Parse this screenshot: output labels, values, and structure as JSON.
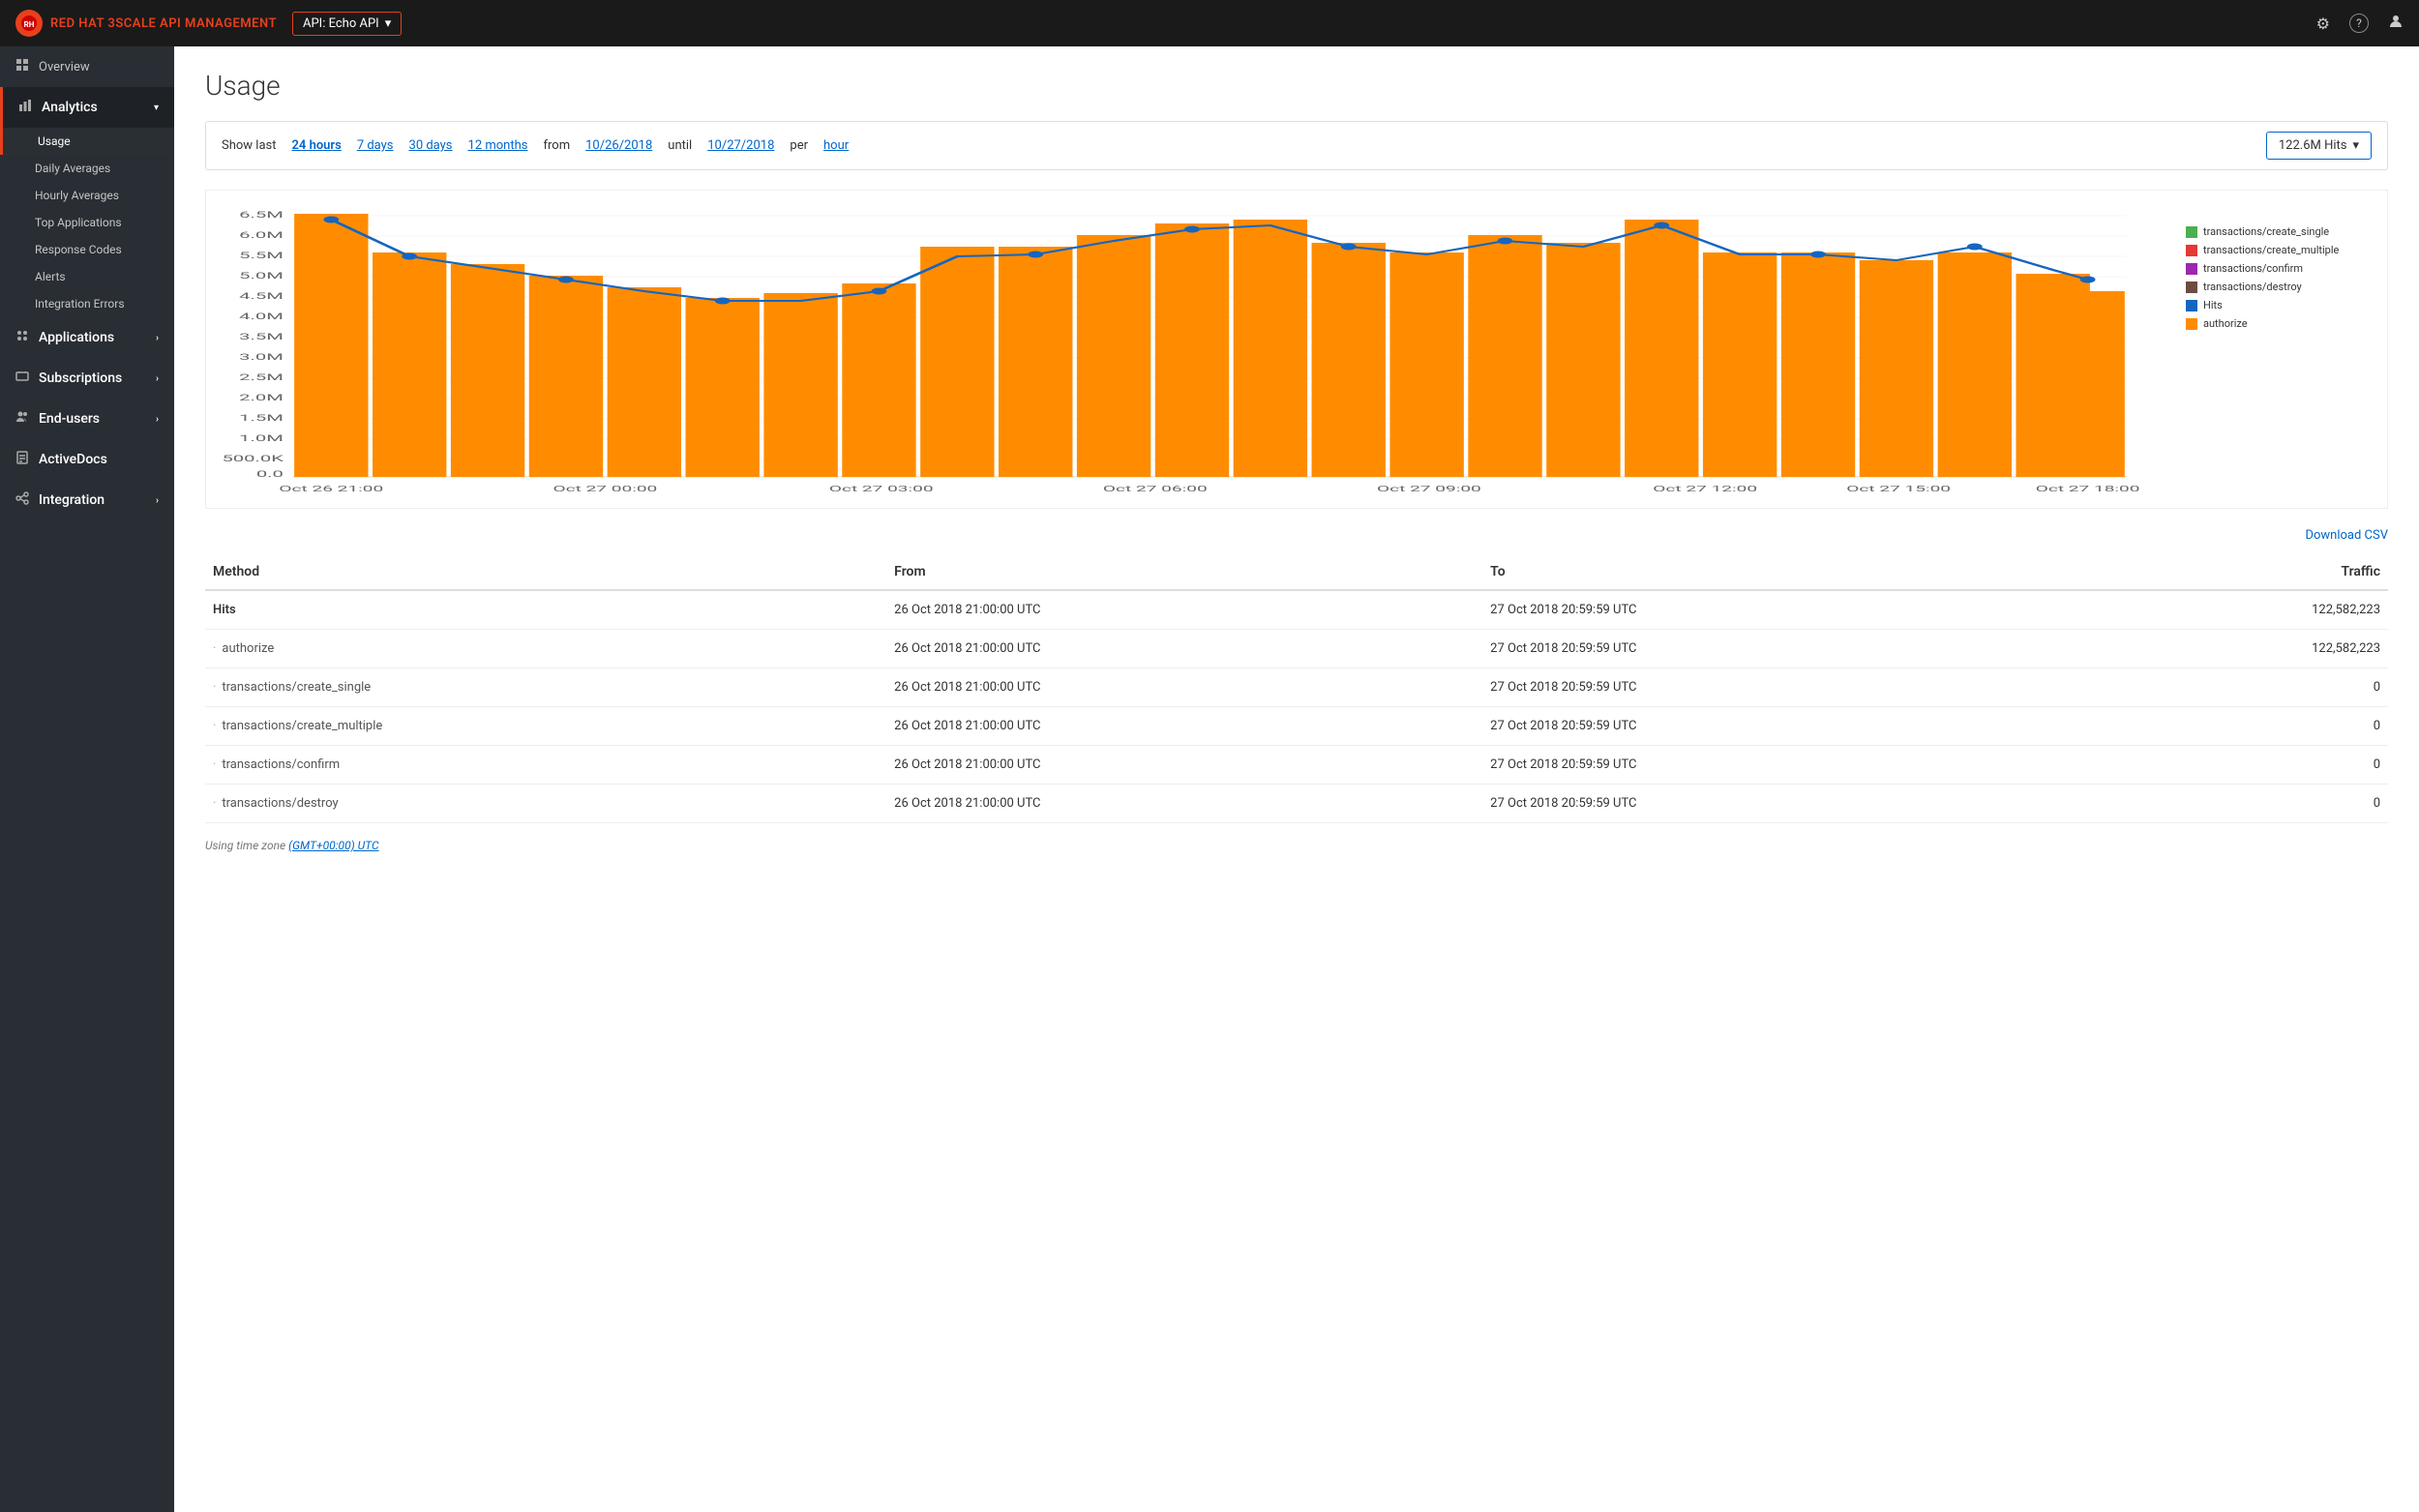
{
  "topnav": {
    "logo_icon": "3S",
    "logo_prefix": "RED HAT ",
    "logo_brand": "3SCALE",
    "logo_suffix": " API MANAGEMENT",
    "api_selector_label": "API: Echo API",
    "gear_icon": "⚙",
    "help_icon": "?",
    "user_icon": "👤"
  },
  "sidebar": {
    "overview_label": "Overview",
    "analytics_label": "Analytics",
    "usage_label": "Usage",
    "daily_averages_label": "Daily Averages",
    "hourly_averages_label": "Hourly Averages",
    "top_applications_label": "Top Applications",
    "response_codes_label": "Response Codes",
    "alerts_label": "Alerts",
    "integration_errors_label": "Integration Errors",
    "applications_label": "Applications",
    "subscriptions_label": "Subscriptions",
    "end_users_label": "End-users",
    "activedocs_label": "ActiveDocs",
    "integration_label": "Integration"
  },
  "page": {
    "title": "Usage"
  },
  "filter": {
    "show_last_label": "Show last",
    "hours_24": "24 hours",
    "days_7": "7 days",
    "days_30": "30 days",
    "months_12": "12 months",
    "from_label": "from",
    "from_date": "10/26/2018",
    "until_label": "until",
    "until_date": "10/27/2018",
    "per_label": "per",
    "period": "hour",
    "hits_label": "122.6M Hits"
  },
  "legend": {
    "items": [
      {
        "label": "transactions/create_single",
        "color": "#4caf50"
      },
      {
        "label": "transactions/create_multiple",
        "color": "#e53935"
      },
      {
        "label": "transactions/confirm",
        "color": "#9c27b0"
      },
      {
        "label": "transactions/destroy",
        "color": "#6d4c41"
      },
      {
        "label": "Hits",
        "color": "#1565c0"
      },
      {
        "label": "authorize",
        "color": "#ff8c00"
      }
    ]
  },
  "chart": {
    "y_labels": [
      "6.5M",
      "6.0M",
      "5.5M",
      "5.0M",
      "4.5M",
      "4.0M",
      "3.5M",
      "3.0M",
      "2.5M",
      "2.0M",
      "1.5M",
      "1.0M",
      "500.0K",
      "0.0"
    ],
    "x_labels": [
      "Oct 26 21:00",
      "Oct 27 00:00",
      "Oct 27 03:00",
      "Oct 27 06:00",
      "Oct 27 09:00",
      "Oct 27 12:00",
      "Oct 27 15:00",
      "Oct 27 18:00"
    ],
    "bars": [
      100,
      87,
      82,
      78,
      74,
      70,
      72,
      75,
      88,
      88,
      92,
      95,
      96,
      90,
      88,
      92,
      90,
      96,
      88,
      88,
      85,
      88,
      80,
      75
    ],
    "line": [
      96,
      87,
      82,
      76,
      72,
      68,
      68,
      72,
      80,
      82,
      86,
      90,
      93,
      88,
      86,
      89,
      87,
      93,
      85,
      85,
      82,
      86,
      78,
      73
    ]
  },
  "download_csv_label": "Download CSV",
  "table": {
    "headers": [
      "Method",
      "From",
      "To",
      "Traffic"
    ],
    "rows": [
      {
        "method": "Hits",
        "from": "26 Oct 2018 21:00:00 UTC",
        "to": "27 Oct 2018 20:59:59 UTC",
        "traffic": "122,582,223",
        "sub": false
      },
      {
        "method": "authorize",
        "from": "26 Oct 2018 21:00:00 UTC",
        "to": "27 Oct 2018 20:59:59 UTC",
        "traffic": "122,582,223",
        "sub": true
      },
      {
        "method": "transactions/create_single",
        "from": "26 Oct 2018 21:00:00 UTC",
        "to": "27 Oct 2018 20:59:59 UTC",
        "traffic": "0",
        "sub": true
      },
      {
        "method": "transactions/create_multiple",
        "from": "26 Oct 2018 21:00:00 UTC",
        "to": "27 Oct 2018 20:59:59 UTC",
        "traffic": "0",
        "sub": true
      },
      {
        "method": "transactions/confirm",
        "from": "26 Oct 2018 21:00:00 UTC",
        "to": "27 Oct 2018 20:59:59 UTC",
        "traffic": "0",
        "sub": true
      },
      {
        "method": "transactions/destroy",
        "from": "26 Oct 2018 21:00:00 UTC",
        "to": "27 Oct 2018 20:59:59 UTC",
        "traffic": "0",
        "sub": true
      }
    ]
  },
  "timezone_note": "Using time zone",
  "timezone_link": "(GMT+00:00) UTC"
}
